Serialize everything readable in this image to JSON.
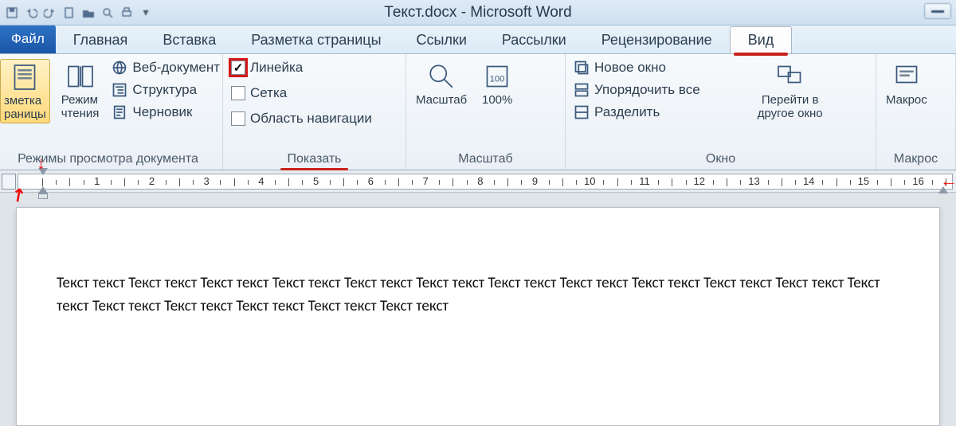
{
  "title": "Текст.docx - Microsoft Word",
  "qat": [
    "save",
    "undo",
    "redo",
    "new",
    "open",
    "print-preview",
    "quick-print",
    "more"
  ],
  "file_tab": "Файл",
  "tabs": [
    {
      "id": "home",
      "label": "Главная"
    },
    {
      "id": "insert",
      "label": "Вставка"
    },
    {
      "id": "layout",
      "label": "Разметка страницы"
    },
    {
      "id": "refs",
      "label": "Ссылки"
    },
    {
      "id": "mail",
      "label": "Рассылки"
    },
    {
      "id": "review",
      "label": "Рецензирование"
    },
    {
      "id": "view",
      "label": "Вид",
      "active": true
    }
  ],
  "groups": {
    "views": {
      "label": "Режимы просмотра документа",
      "big": [
        {
          "id": "page-layout",
          "label": "зметка\nраницы",
          "selected": true,
          "cut": true
        },
        {
          "id": "reading",
          "label": "Режим\nчтения"
        }
      ],
      "list": [
        {
          "id": "web",
          "label": "Веб-документ"
        },
        {
          "id": "outline",
          "label": "Структура"
        },
        {
          "id": "draft",
          "label": "Черновик"
        }
      ]
    },
    "show": {
      "label": "Показать",
      "checks": [
        {
          "id": "ruler",
          "label": "Линейка",
          "checked": true,
          "highlight": true
        },
        {
          "id": "grid",
          "label": "Сетка",
          "checked": false
        },
        {
          "id": "nav",
          "label": "Область навигации",
          "checked": false
        }
      ]
    },
    "zoom": {
      "label": "Масштаб",
      "big": [
        {
          "id": "zoom",
          "label": "Масштаб"
        },
        {
          "id": "hundred",
          "label": "100%"
        }
      ],
      "small": [
        "one-page",
        "two-pages",
        "page-width"
      ]
    },
    "window": {
      "label": "Окно",
      "list": [
        {
          "id": "new-window",
          "label": "Новое окно"
        },
        {
          "id": "arrange",
          "label": "Упорядочить все"
        },
        {
          "id": "split",
          "label": "Разделить"
        }
      ],
      "side": [
        "sync-scroll",
        "reset-pos"
      ],
      "big": {
        "id": "switch",
        "label": "Перейти в\nдругое окно"
      }
    },
    "macros": {
      "label": "Макрос",
      "big": {
        "id": "macros",
        "label": "Макрос"
      }
    }
  },
  "ruler": {
    "min": 1,
    "max": 16
  },
  "document": {
    "paragraph": "Текст текст Текст текст Текст текст Текст текст Текст текст Текст текст Текст текст Текст текст Текст текст Текст текст Текст текст Текст текст Текст текст Текст текст Текст текст Текст текст Текст текст"
  }
}
